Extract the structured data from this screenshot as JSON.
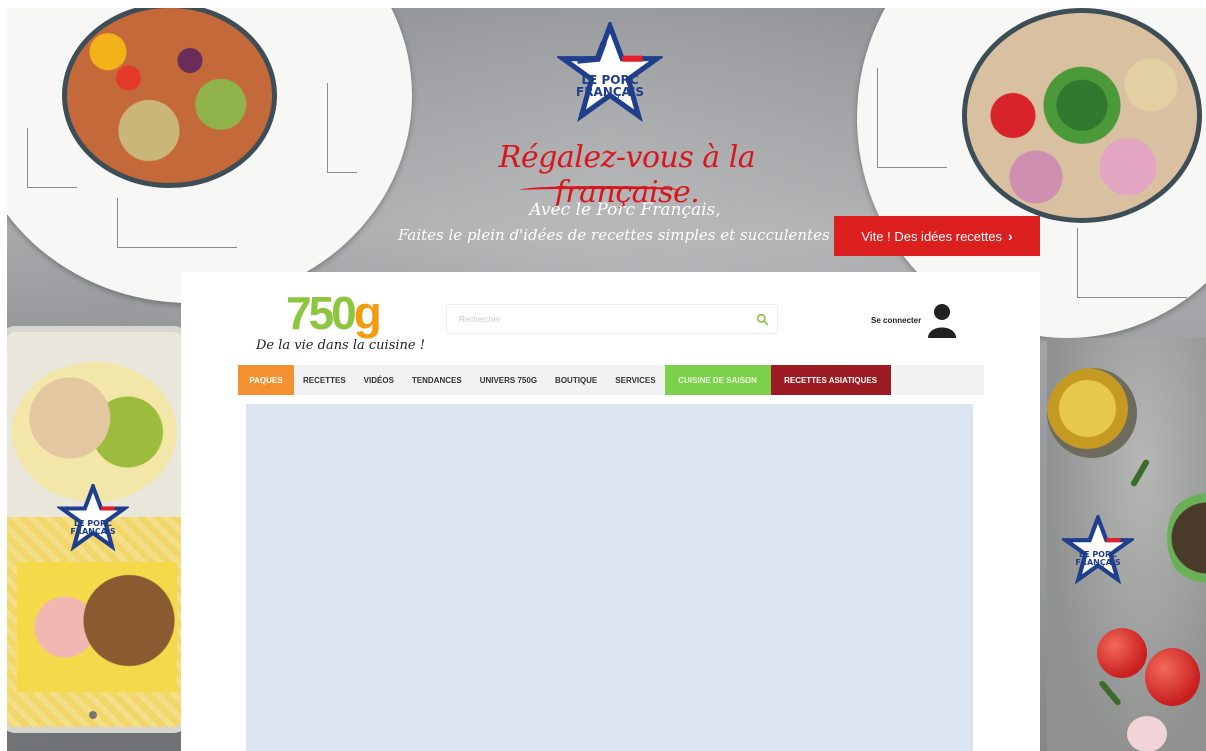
{
  "banner": {
    "brand_badge_line1": "LE PORC",
    "brand_badge_line2": "FRANÇAIS",
    "title": "Régalez-vous à la française.",
    "subtitle_line1": "Avec le Porc Français,",
    "subtitle_line2": "Faites le plein d'idées de recettes simples et succulentes",
    "cta_label": "Vite ! Des idées recettes",
    "cta_icon": "chevron-right-icon",
    "colors": {
      "accent_red": "#dc1f1f",
      "brand_blue": "#1f3e8c"
    }
  },
  "header": {
    "logo_number": "750",
    "logo_letter": "g",
    "tagline": "De la vie dans la cuisine !",
    "search": {
      "placeholder": "Rechercher",
      "icon": "search-icon"
    },
    "login": {
      "label": "Se connecter",
      "icon": "user-avatar-icon"
    },
    "colors": {
      "logo_green": "#8cc63f",
      "logo_orange": "#f39c12"
    }
  },
  "nav": {
    "items": [
      {
        "label": "PAQUES"
      },
      {
        "label": "RECETTES"
      },
      {
        "label": "VIDÉOS"
      },
      {
        "label": "TENDANCES"
      },
      {
        "label": "UNIVERS 750G"
      },
      {
        "label": "BOUTIQUE"
      },
      {
        "label": "SERVICES"
      },
      {
        "label": "CUISINE DE SAISON"
      },
      {
        "label": "RECETTES ASIATIQUES"
      }
    ],
    "colors": {
      "paques": "#f39130",
      "saison": "#7cd14a",
      "asia": "#9c1b22"
    }
  }
}
